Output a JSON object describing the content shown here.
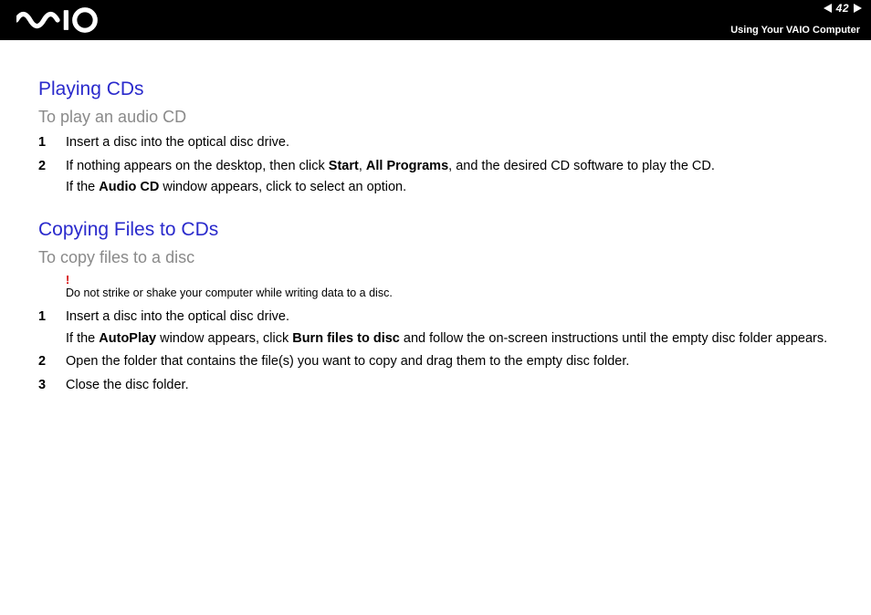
{
  "header": {
    "page_number": "42",
    "section": "Using Your VAIO Computer"
  },
  "section1": {
    "title": "Playing CDs",
    "subtitle": "To play an audio CD",
    "steps": [
      {
        "n": "1",
        "lines": [
          {
            "runs": [
              {
                "t": "Insert a disc into the optical disc drive."
              }
            ]
          }
        ]
      },
      {
        "n": "2",
        "lines": [
          {
            "runs": [
              {
                "t": "If nothing appears on the desktop, then click "
              },
              {
                "t": "Start",
                "b": true
              },
              {
                "t": ", "
              },
              {
                "t": "All Programs",
                "b": true
              },
              {
                "t": ", and the desired CD software to play the CD."
              }
            ]
          },
          {
            "runs": [
              {
                "t": "If the "
              },
              {
                "t": "Audio CD",
                "b": true
              },
              {
                "t": " window appears, click to select an option."
              }
            ]
          }
        ]
      }
    ]
  },
  "section2": {
    "title": "Copying Files to CDs",
    "subtitle": "To copy files to a disc",
    "warning_mark": "!",
    "warning_text": "Do not strike or shake your computer while writing data to a disc.",
    "steps": [
      {
        "n": "1",
        "lines": [
          {
            "runs": [
              {
                "t": "Insert a disc into the optical disc drive."
              }
            ]
          },
          {
            "runs": [
              {
                "t": "If the "
              },
              {
                "t": "AutoPlay",
                "b": true
              },
              {
                "t": " window appears, click "
              },
              {
                "t": "Burn files to disc",
                "b": true
              },
              {
                "t": " and follow the on-screen instructions until the empty disc folder appears."
              }
            ]
          }
        ]
      },
      {
        "n": "2",
        "lines": [
          {
            "runs": [
              {
                "t": "Open the folder that contains the file(s) you want to copy and drag them to the empty disc folder."
              }
            ]
          }
        ]
      },
      {
        "n": "3",
        "lines": [
          {
            "runs": [
              {
                "t": "Close the disc folder."
              }
            ]
          }
        ]
      }
    ]
  }
}
